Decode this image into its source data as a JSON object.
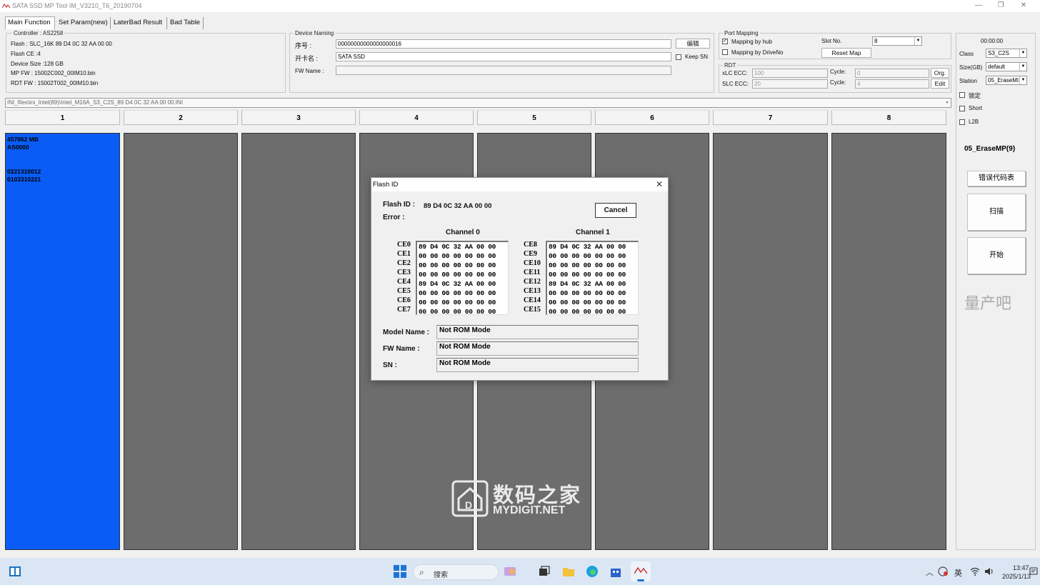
{
  "window": {
    "title": "SATA SSD MP Tool IM_V3210_T6_20190704",
    "min": "—",
    "max": "❐",
    "close": "✕"
  },
  "tabs": [
    {
      "label": "Main Function"
    },
    {
      "label": "Set Param(new)"
    },
    {
      "label": "LaterBad Result"
    },
    {
      "label": "Bad Table"
    }
  ],
  "controller": {
    "group": "Controller : AS2258",
    "flash": "Flash : SLC_16K 89 D4 0C 32 AA 00 00",
    "flash_ce": "Flash CE :4",
    "device_size": "Device Size :128 GB",
    "mp_fw": "MP FW :   15002C002_00IM10.bin",
    "rdt_fw": "RDT FW : 15002T002_00IM10.bin"
  },
  "device_naming": {
    "group": "Device Naming",
    "serial_label": "序号 :",
    "serial_value": "00000000000000000016",
    "edit_btn": "编辑",
    "card_name_label": "开卡名 :",
    "card_name_value": "SATA SSD",
    "keep_sn": "Keep SN",
    "fw_name_label": "FW Name :",
    "fw_name_value": ""
  },
  "port_mapping": {
    "group": "Port Mapping",
    "by_hub": "Mapping by hub",
    "by_hub_checked": "✓",
    "by_drive": "Mapping by DriveNo",
    "slot_label": "Slot No.",
    "slot_value": "8",
    "reset_map": "Reset Map"
  },
  "rdt": {
    "group": "RDT",
    "xlc_label": "xLC ECC:",
    "xlc_value": "100",
    "slc_label": "SLC ECC:",
    "slc_value": "20",
    "cycle_label": "Cycle:",
    "cycle1": "0",
    "cycle2": "4",
    "org_btn": "Org.",
    "edit_btn": "Edit"
  },
  "ini_path": "INI_files\\ini_Intel(89)\\Intel_M16A_S3_C2S_89 D4 0C 32 AA 00 00.INI",
  "columns": [
    "1",
    "2",
    "3",
    "4",
    "5",
    "6",
    "7",
    "8"
  ],
  "slot1": {
    "line1": "457862 MB",
    "line2": "AS0000",
    "line3": "0221310012",
    "line4": "0103310221"
  },
  "side": {
    "timer": "00:00:00",
    "class_label": "Class",
    "class_value": "S3_C2S",
    "size_label": "Size(GB)",
    "size_value": "default",
    "station_label": "Station",
    "station_value": "05_EraseMI",
    "lock": "锁定",
    "short": "Short",
    "l2b": "L2B",
    "mode": "05_EraseMP(9)",
    "err_table": "错误代码表",
    "scan": "扫描",
    "start": "开始",
    "watermark": "量产吧"
  },
  "dialog": {
    "title": "Flash ID",
    "flash_id_label": "Flash ID :",
    "flash_id_value": "89 D4 0C 32 AA 00 00",
    "error_label": "Error :",
    "cancel": "Cancel",
    "channel0": {
      "title": "Channel 0",
      "rows": [
        {
          "ce": "CE0",
          "v": "89 D4 0C 32 AA 00 00"
        },
        {
          "ce": "CE1",
          "v": "00 00 00 00 00 00 00"
        },
        {
          "ce": "CE2",
          "v": "00 00 00 00 00 00 00"
        },
        {
          "ce": "CE3",
          "v": "00 00 00 00 00 00 00"
        },
        {
          "ce": "CE4",
          "v": "89 D4 0C 32 AA 00 00"
        },
        {
          "ce": "CE5",
          "v": "00 00 00 00 00 00 00"
        },
        {
          "ce": "CE6",
          "v": "00 00 00 00 00 00 00"
        },
        {
          "ce": "CE7",
          "v": "00 00 00 00 00 00 00"
        }
      ]
    },
    "channel1": {
      "title": "Channel 1",
      "rows": [
        {
          "ce": "CE8",
          "v": "89 D4 0C 32 AA 00 00"
        },
        {
          "ce": "CE9",
          "v": "00 00 00 00 00 00 00"
        },
        {
          "ce": "CE10",
          "v": "00 00 00 00 00 00 00"
        },
        {
          "ce": "CE11",
          "v": "00 00 00 00 00 00 00"
        },
        {
          "ce": "CE12",
          "v": "89 D4 0C 32 AA 00 00"
        },
        {
          "ce": "CE13",
          "v": "00 00 00 00 00 00 00"
        },
        {
          "ce": "CE14",
          "v": "00 00 00 00 00 00 00"
        },
        {
          "ce": "CE15",
          "v": "00 00 00 00 00 00 00"
        }
      ]
    },
    "model_label": "Model Name :",
    "model_value": "Not ROM Mode",
    "fw_label": "FW Name :",
    "fw_value": "Not ROM Mode",
    "sn_label": "SN :",
    "sn_value": "Not ROM Mode"
  },
  "watermark": {
    "cn": "数码之家",
    "en": "MYDIGIT.NET"
  },
  "taskbar": {
    "search": "搜索",
    "ime": "英",
    "time": "13:47",
    "date": "2025/1/13"
  },
  "colors": {
    "slot_active": "#0a5cf7",
    "slot_idle": "#6d6d6d",
    "taskbar": "#dbe6f4"
  }
}
